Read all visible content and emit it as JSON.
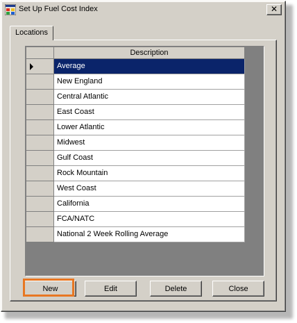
{
  "window": {
    "title": "Set Up Fuel Cost Index",
    "close_glyph": "✕"
  },
  "tabs": [
    {
      "label": "Locations",
      "active": true
    }
  ],
  "grid": {
    "column_header": "Description",
    "selected_index": 0,
    "rows": [
      "Average",
      "New England",
      "Central Atlantic",
      "East Coast",
      "Lower Atlantic",
      "Midwest",
      "Gulf Coast",
      "Rock Mountain",
      "West Coast",
      "California",
      "FCA/NATC",
      "National 2 Week Rolling Average"
    ]
  },
  "buttons": {
    "new": "New",
    "edit": "Edit",
    "delete": "Delete",
    "close": "Close"
  },
  "colors": {
    "selection": "#0a246a",
    "highlight_outline": "#e87722",
    "dialog_face": "#d4d0c8"
  }
}
